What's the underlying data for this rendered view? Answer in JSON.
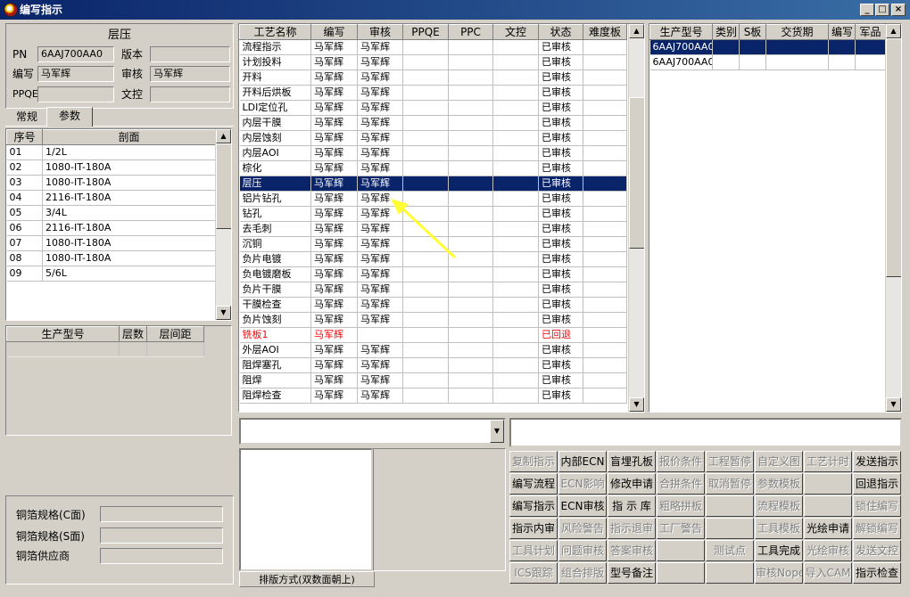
{
  "window": {
    "title": "编写指示",
    "minimize": "_",
    "maximize": "□",
    "close": "×"
  },
  "left": {
    "group_title": "层压",
    "fields": {
      "pn_label": "PN",
      "pn_value": "6AAJ700AA0",
      "version_label": "版本",
      "version_value": "",
      "author_label": "编写",
      "author_value": "马军辉",
      "reviewer_label": "审核",
      "reviewer_value": "马军辉",
      "ppqe_label": "PPQE",
      "ppqe_value": "",
      "doc_label": "文控",
      "doc_value": ""
    },
    "tabs": [
      "常规",
      "参数"
    ],
    "section_table": {
      "headers": [
        "序号",
        "剖面"
      ],
      "rows": [
        [
          "01",
          "1/2L"
        ],
        [
          "02",
          "1080-IT-180A"
        ],
        [
          "03",
          "1080-IT-180A"
        ],
        [
          "04",
          "2116-IT-180A"
        ],
        [
          "05",
          "3/4L"
        ],
        [
          "06",
          "2116-IT-180A"
        ],
        [
          "07",
          "1080-IT-180A"
        ],
        [
          "08",
          "1080-IT-180A"
        ],
        [
          "09",
          "5/6L"
        ]
      ]
    },
    "model_table": {
      "headers": [
        "生产型号",
        "层数",
        "层间距"
      ]
    },
    "copper": {
      "c_label": "铜箔规格(C面)",
      "c_value": "",
      "s_label": "铜箔规格(S面)",
      "s_value": "",
      "supplier_label": "铜箔供应商",
      "supplier_value": ""
    }
  },
  "process_table": {
    "headers": [
      "工艺名称",
      "编写",
      "审核",
      "PPQE",
      "PPC",
      "文控",
      "状态",
      "难度板"
    ],
    "selected_index": 9,
    "returned_index": 19,
    "rows": [
      [
        "流程指示",
        "马军辉",
        "马军辉",
        "",
        "",
        "",
        "已审核",
        ""
      ],
      [
        "计划投料",
        "马军辉",
        "马军辉",
        "",
        "",
        "",
        "已审核",
        ""
      ],
      [
        "开料",
        "马军辉",
        "马军辉",
        "",
        "",
        "",
        "已审核",
        ""
      ],
      [
        "开料后烘板",
        "马军辉",
        "马军辉",
        "",
        "",
        "",
        "已审核",
        ""
      ],
      [
        "LDI定位孔",
        "马军辉",
        "马军辉",
        "",
        "",
        "",
        "已审核",
        ""
      ],
      [
        "内层干膜",
        "马军辉",
        "马军辉",
        "",
        "",
        "",
        "已审核",
        ""
      ],
      [
        "内层蚀刻",
        "马军辉",
        "马军辉",
        "",
        "",
        "",
        "已审核",
        ""
      ],
      [
        "内层AOI",
        "马军辉",
        "马军辉",
        "",
        "",
        "",
        "已审核",
        ""
      ],
      [
        "棕化",
        "马军辉",
        "马军辉",
        "",
        "",
        "",
        "已审核",
        ""
      ],
      [
        "层压",
        "马军辉",
        "马军辉",
        "",
        "",
        "",
        "已审核",
        ""
      ],
      [
        "铝片钻孔",
        "马军辉",
        "马军辉",
        "",
        "",
        "",
        "已审核",
        ""
      ],
      [
        "钻孔",
        "马军辉",
        "马军辉",
        "",
        "",
        "",
        "已审核",
        ""
      ],
      [
        "去毛刺",
        "马军辉",
        "马军辉",
        "",
        "",
        "",
        "已审核",
        ""
      ],
      [
        "沉铜",
        "马军辉",
        "马军辉",
        "",
        "",
        "",
        "已审核",
        ""
      ],
      [
        "负片电镀",
        "马军辉",
        "马军辉",
        "",
        "",
        "",
        "已审核",
        ""
      ],
      [
        "负电镀磨板",
        "马军辉",
        "马军辉",
        "",
        "",
        "",
        "已审核",
        ""
      ],
      [
        "负片干膜",
        "马军辉",
        "马军辉",
        "",
        "",
        "",
        "已审核",
        ""
      ],
      [
        "干膜检查",
        "马军辉",
        "马军辉",
        "",
        "",
        "",
        "已审核",
        ""
      ],
      [
        "负片蚀刻",
        "马军辉",
        "马军辉",
        "",
        "",
        "",
        "已审核",
        ""
      ],
      [
        "铣板1",
        "马军辉",
        "",
        "",
        "",
        "",
        "已回退",
        ""
      ],
      [
        "外层AOI",
        "马军辉",
        "马军辉",
        "",
        "",
        "",
        "已审核",
        ""
      ],
      [
        "阻焊塞孔",
        "马军辉",
        "马军辉",
        "",
        "",
        "",
        "已审核",
        ""
      ],
      [
        "阻焊",
        "马军辉",
        "马军辉",
        "",
        "",
        "",
        "已审核",
        ""
      ],
      [
        "阻焊检查",
        "马军辉",
        "马军辉",
        "",
        "",
        "",
        "已审核",
        ""
      ]
    ]
  },
  "model_grid": {
    "headers": [
      "生产型号",
      "类别",
      "S板",
      "交货期",
      "编写",
      "军品"
    ],
    "rows": [
      [
        "6AAJ700AA0",
        "",
        "",
        "",
        "",
        ""
      ],
      [
        "6AAJ700AA0",
        "",
        "",
        "",
        "",
        ""
      ]
    ]
  },
  "bottom": {
    "combo_value": "",
    "text_value": "",
    "layout_label": "排版方式(双数面朝上)"
  },
  "buttons": [
    {
      "label": "复制指示",
      "enabled": false
    },
    {
      "label": "内部ECN",
      "enabled": true
    },
    {
      "label": "盲埋孔板",
      "enabled": true
    },
    {
      "label": "报价条件",
      "enabled": false
    },
    {
      "label": "工程暂停",
      "enabled": false
    },
    {
      "label": "自定义图",
      "enabled": false
    },
    {
      "label": "工艺计时",
      "enabled": false
    },
    {
      "label": "发送指示",
      "enabled": true
    },
    {
      "label": "编写流程",
      "enabled": true
    },
    {
      "label": "ECN影响",
      "enabled": false
    },
    {
      "label": "修改申请",
      "enabled": true
    },
    {
      "label": "合拼条件",
      "enabled": false
    },
    {
      "label": "取消暂停",
      "enabled": false
    },
    {
      "label": "参数模板",
      "enabled": false
    },
    {
      "label": "",
      "enabled": false
    },
    {
      "label": "回退指示",
      "enabled": true
    },
    {
      "label": "编写指示",
      "enabled": true
    },
    {
      "label": "ECN审核",
      "enabled": true
    },
    {
      "label": "指 示 库",
      "enabled": true
    },
    {
      "label": "粗略拼板",
      "enabled": false
    },
    {
      "label": "",
      "enabled": false
    },
    {
      "label": "流程模板",
      "enabled": false
    },
    {
      "label": "",
      "enabled": false
    },
    {
      "label": "锁住编写",
      "enabled": false
    },
    {
      "label": "指示内审",
      "enabled": true
    },
    {
      "label": "风险警告",
      "enabled": false
    },
    {
      "label": "指示退审",
      "enabled": false
    },
    {
      "label": "工厂警告",
      "enabled": false
    },
    {
      "label": "",
      "enabled": false
    },
    {
      "label": "工具模板",
      "enabled": false
    },
    {
      "label": "光绘申请",
      "enabled": true
    },
    {
      "label": "解锁编写",
      "enabled": false
    },
    {
      "label": "工具计划",
      "enabled": false
    },
    {
      "label": "问题审核",
      "enabled": false
    },
    {
      "label": "答案审核",
      "enabled": false
    },
    {
      "label": "",
      "enabled": false
    },
    {
      "label": "测试点",
      "enabled": false
    },
    {
      "label": "工具完成",
      "enabled": true
    },
    {
      "label": "光绘审核",
      "enabled": false
    },
    {
      "label": "发送文控",
      "enabled": false
    },
    {
      "label": "ICS跟踪",
      "enabled": false
    },
    {
      "label": "组合排版",
      "enabled": false
    },
    {
      "label": "型号备注",
      "enabled": true
    },
    {
      "label": "",
      "enabled": false
    },
    {
      "label": "",
      "enabled": false
    },
    {
      "label": "审核Nope",
      "enabled": false
    },
    {
      "label": "导入CAM",
      "enabled": false
    },
    {
      "label": "指示检查",
      "enabled": true
    }
  ],
  "colors": {
    "title_bar": "#0a246a",
    "selection": "#0a246a",
    "returned_text": "#ff0000",
    "window_bg": "#d4d0c8",
    "annotation_arrow": "#ffff33"
  }
}
